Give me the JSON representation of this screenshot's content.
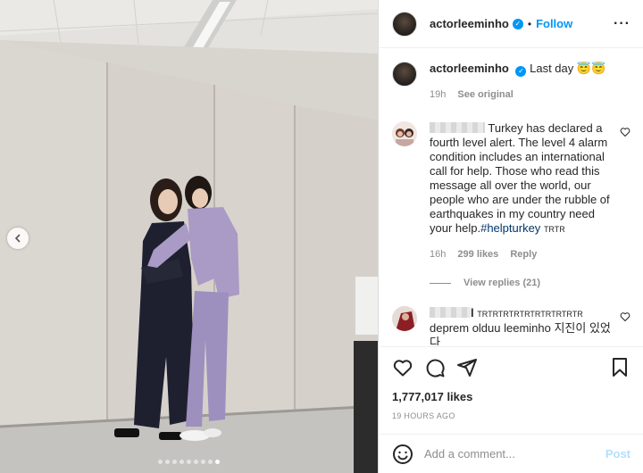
{
  "post": {
    "username": "actorleeminho",
    "follow_label": "Follow",
    "separator": "•",
    "caption_text": "Last day 😇😇",
    "caption_time": "19h",
    "see_original_label": "See original",
    "carousel": {
      "slide_count": 9,
      "active_index": 8
    }
  },
  "comments": [
    {
      "text": "Turkey has declared a fourth level alert. The level 4 alarm condition includes an international call for help. Those who read this message all over the world, our people who are under the rubble of earthquakes in my country need your help.",
      "hashtag": "#helpturkey",
      "suffix": "TRTR",
      "time": "16h",
      "likes": "299 likes",
      "reply_label": "Reply",
      "view_replies": "View replies (21)"
    },
    {
      "username_suffix": "l",
      "tag": "TRTRTRTRTRTRTRTRTRTR",
      "text": "deprem olduu leeminho 지진이 있었다"
    }
  ],
  "stats": {
    "likes": "1,777,017 likes",
    "time_ago": "19 HOURS AGO"
  },
  "comment_box": {
    "placeholder": "Add a comment...",
    "post_label": "Post"
  },
  "icons": {
    "prev": "chevron-left-icon",
    "verified": "verified-badge-icon",
    "more": "more-options-icon",
    "heart": "heart-icon",
    "like": "like-icon",
    "comment": "comment-icon",
    "share": "share-icon",
    "save": "bookmark-icon",
    "emoji": "emoji-icon"
  },
  "colors": {
    "accent": "#0095f6",
    "hashtag": "#00376b",
    "muted": "#8e8e8e"
  }
}
